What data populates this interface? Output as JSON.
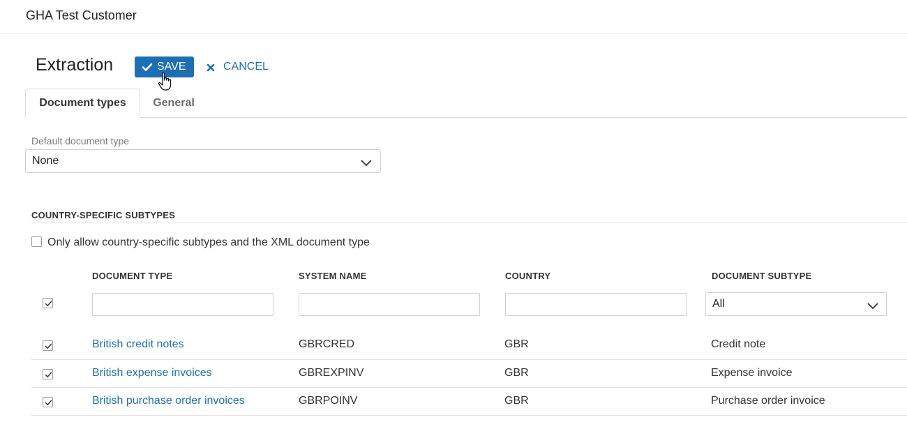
{
  "header": {
    "customer_name": "GHA Test Customer"
  },
  "page": {
    "title": "Extraction"
  },
  "actions": {
    "save_label": "SAVE",
    "cancel_label": "CANCEL"
  },
  "tabs": [
    {
      "label": "Document types",
      "active": true
    },
    {
      "label": "General",
      "active": false
    }
  ],
  "default_document_type": {
    "label": "Default document type",
    "value": "None"
  },
  "country_subtypes": {
    "heading": "COUNTRY-SPECIFIC SUBTYPES",
    "only_allow_label": "Only allow country-specific subtypes and the XML document type",
    "only_allow_checked": false
  },
  "table": {
    "columns": [
      "DOCUMENT TYPE",
      "SYSTEM NAME",
      "COUNTRY",
      "DOCUMENT SUBTYPE"
    ],
    "filters": {
      "document_type": "",
      "system_name": "",
      "country": "",
      "document_subtype": "All"
    },
    "select_all_checked": true,
    "rows": [
      {
        "checked": true,
        "document_type": "British credit notes",
        "system_name": "GBRCRED",
        "country": "GBR",
        "document_subtype": "Credit note"
      },
      {
        "checked": true,
        "document_type": "British expense invoices",
        "system_name": "GBREXPINV",
        "country": "GBR",
        "document_subtype": "Expense invoice"
      },
      {
        "checked": true,
        "document_type": "British purchase order invoices",
        "system_name": "GBRPOINV",
        "country": "GBR",
        "document_subtype": "Purchase order invoice"
      }
    ]
  },
  "colors": {
    "accent": "#1d6fb3",
    "border": "#cfcfcf",
    "muted_text": "#777777"
  },
  "icons": {
    "save": "check-icon",
    "cancel": "close-icon",
    "dropdown": "chevron-down-icon",
    "cursor": "hand-pointer-icon"
  }
}
